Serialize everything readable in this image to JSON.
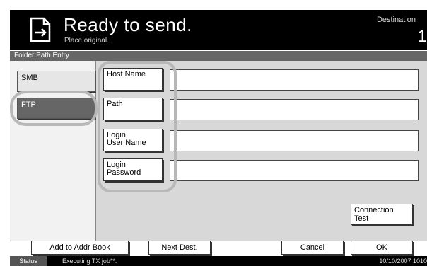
{
  "header": {
    "title": "Ready to send.",
    "subtitle": "Place original.",
    "destination_label": "Destination",
    "destination_count": "1"
  },
  "subheader": {
    "title": "Folder Path Entry"
  },
  "protocols": [
    {
      "label": "SMB",
      "selected": false
    },
    {
      "label": "FTP",
      "selected": true
    }
  ],
  "fields": {
    "host_name": {
      "label": "Host Name",
      "value": ""
    },
    "path": {
      "label": "Path",
      "value": ""
    },
    "login_user": {
      "label_line1": "Login",
      "label_line2": "User Name",
      "value": ""
    },
    "login_password": {
      "label_line1": "Login",
      "label_line2": "Password",
      "value": ""
    }
  },
  "connection_test": {
    "line1": "Connection",
    "line2": "Test"
  },
  "bottom": {
    "add_to_addr_book": "Add to Addr Book",
    "next_dest": "Next Dest.",
    "cancel": "Cancel",
    "ok": "OK"
  },
  "status": {
    "button": "Status",
    "message": "Executing TX job**.",
    "time": "10/10/2007  1010"
  },
  "colors": {
    "header_bg": "#000000",
    "selected_protocol": "#666666",
    "panel_bg": "#d8d8d8"
  },
  "icons": {
    "send": "document-send-icon"
  }
}
